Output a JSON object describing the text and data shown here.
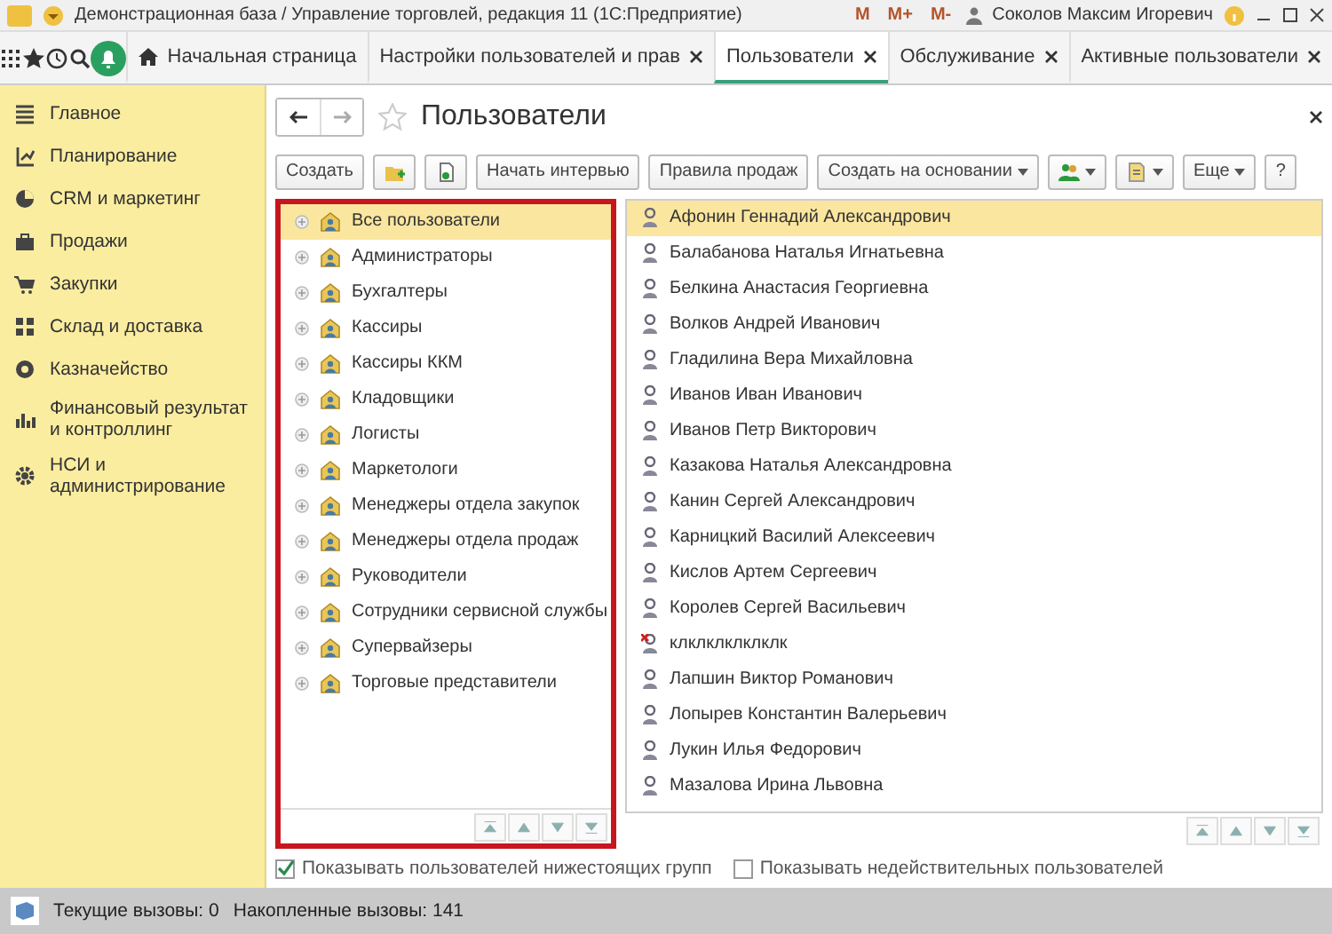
{
  "title_bar": {
    "title": "Демонстрационная база / Управление торговлей, редакция 11  (1С:Предприятие)",
    "memory_buttons": [
      "M",
      "M+",
      "M-"
    ],
    "user": "Соколов Максим Игоревич"
  },
  "tabs": [
    {
      "label": "Начальная страница",
      "selected": false,
      "closable": false
    },
    {
      "label": "Настройки пользователей и прав",
      "selected": false,
      "closable": true
    },
    {
      "label": "Пользователи",
      "selected": true,
      "closable": true
    },
    {
      "label": "Обслуживание",
      "selected": false,
      "closable": true
    },
    {
      "label": "Активные пользователи",
      "selected": false,
      "closable": true
    }
  ],
  "sidebar": {
    "items": [
      {
        "label": "Главное",
        "kind": "menu"
      },
      {
        "label": "Планирование",
        "kind": "plan"
      },
      {
        "label": "CRM и маркетинг",
        "kind": "pie"
      },
      {
        "label": "Продажи",
        "kind": "bag"
      },
      {
        "label": "Закупки",
        "kind": "cart"
      },
      {
        "label": "Склад и доставка",
        "kind": "grid"
      },
      {
        "label": "Казначейство",
        "kind": "coin"
      },
      {
        "label": "Финансовый результат и контроллинг",
        "kind": "bars"
      },
      {
        "label": "НСИ и администрирование",
        "kind": "gear"
      }
    ]
  },
  "form": {
    "title": "Пользователи",
    "toolbar": [
      {
        "kind": "text",
        "label": "Создать"
      },
      {
        "kind": "add-group"
      },
      {
        "kind": "copy"
      },
      {
        "kind": "text",
        "label": "Начать интервью"
      },
      {
        "kind": "text",
        "label": "Правила продаж"
      },
      {
        "kind": "text",
        "label": "Создать на основании",
        "dropdown": true
      },
      {
        "kind": "users",
        "dropdown": true
      },
      {
        "kind": "report",
        "dropdown": true
      },
      {
        "kind": "text",
        "label": "Еще",
        "dropdown": true
      },
      {
        "kind": "text",
        "label": "?"
      }
    ],
    "groups": [
      {
        "label": "Все пользователи",
        "selected": true
      },
      {
        "label": "Администраторы",
        "selected": false
      },
      {
        "label": "Бухгалтеры",
        "selected": false
      },
      {
        "label": "Кассиры",
        "selected": false
      },
      {
        "label": "Кассиры ККМ",
        "selected": false
      },
      {
        "label": "Кладовщики",
        "selected": false
      },
      {
        "label": "Логисты",
        "selected": false
      },
      {
        "label": "Маркетологи",
        "selected": false
      },
      {
        "label": "Менеджеры отдела закупок",
        "selected": false
      },
      {
        "label": "Менеджеры отдела продаж",
        "selected": false
      },
      {
        "label": "Руководители",
        "selected": false
      },
      {
        "label": "Сотрудники сервисной службы",
        "selected": false
      },
      {
        "label": "Супервайзеры",
        "selected": false
      },
      {
        "label": "Торговые представители",
        "selected": false
      }
    ],
    "users": [
      {
        "name": "Афонин Геннадий Александрович",
        "selected": true,
        "deleted": false
      },
      {
        "name": "Балабанова Наталья Игнатьевна",
        "selected": false,
        "deleted": false
      },
      {
        "name": "Белкина Анастасия Георгиевна",
        "selected": false,
        "deleted": false
      },
      {
        "name": "Волков Андрей Иванович",
        "selected": false,
        "deleted": false
      },
      {
        "name": "Гладилина Вера Михайловна",
        "selected": false,
        "deleted": false
      },
      {
        "name": "Иванов Иван Иванович",
        "selected": false,
        "deleted": false
      },
      {
        "name": "Иванов Петр Викторович",
        "selected": false,
        "deleted": false
      },
      {
        "name": "Казакова Наталья Александровна",
        "selected": false,
        "deleted": false
      },
      {
        "name": "Канин Сергей Александрович",
        "selected": false,
        "deleted": false
      },
      {
        "name": "Карницкий Василий Алексеевич",
        "selected": false,
        "deleted": false
      },
      {
        "name": "Кислов Артем Сергеевич",
        "selected": false,
        "deleted": false
      },
      {
        "name": "Королев Сергей Васильевич",
        "selected": false,
        "deleted": false
      },
      {
        "name": "клклклклклклк",
        "selected": false,
        "deleted": true
      },
      {
        "name": "Лапшин Виктор Романович",
        "selected": false,
        "deleted": false
      },
      {
        "name": "Лопырев Константин Валерьевич",
        "selected": false,
        "deleted": false
      },
      {
        "name": "Лукин Илья Федорович",
        "selected": false,
        "deleted": false
      },
      {
        "name": "Мазалова Ирина Львовна",
        "selected": false,
        "deleted": false
      }
    ],
    "options": [
      {
        "label": "Показывать пользователей нижестоящих групп",
        "checked": true
      },
      {
        "label": "Показывать недействительных пользователей",
        "checked": false
      }
    ]
  },
  "status_bar": {
    "current_calls": "Текущие вызовы: 0",
    "total_calls": "Накопленные вызовы: 141"
  }
}
